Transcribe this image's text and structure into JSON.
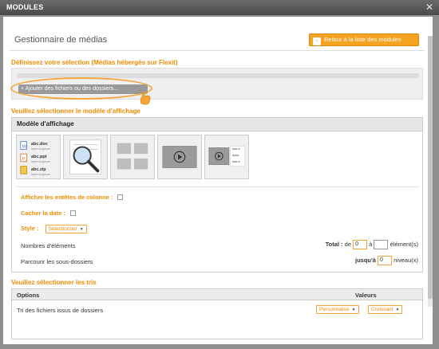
{
  "window": {
    "title": "MODULES"
  },
  "header": {
    "title": "Gestionnaire de médias",
    "back_button": "Retour à la liste des modules"
  },
  "selection": {
    "title": "Définissez votre sélection (Médias hébergés sur Flexit)",
    "add_button": "Ajouter des fichiers ou des dossiers..."
  },
  "model": {
    "section_title": "Veuillez sélectionner le modèle d'affichage",
    "panel_title": "Modèle d'affichage",
    "thumbnails": {
      "list": [
        {
          "name": "abc.doc",
          "sub": "lorem impsum"
        },
        {
          "name": "abc.ppt",
          "sub": "lorem impsum"
        },
        {
          "name": "abc.zip",
          "sub": "lorem impsum"
        }
      ],
      "lines": [
        "lore a",
        "dolor",
        "lore a"
      ]
    },
    "options": {
      "column_headers": "Afficher les entêtes de colonne :",
      "hide_date": "Cacher la date :",
      "style_label": "Style :",
      "style_value": "Sélectionner",
      "elements_label": "Nombres d'éléments",
      "total_label": "Total :",
      "from_label": "de",
      "from_value": "0",
      "to_label": "à",
      "to_value": "",
      "elements_unit": "élément(s)",
      "subfolders_label": "Parcourir les sous-dossiers",
      "depth_label": "jusqu'à",
      "depth_value": "0",
      "depth_unit": "niveau(x)"
    }
  },
  "tris": {
    "section_title": "Veuillez sélectionner les tris",
    "col_options": "Options",
    "col_values": "Valeurs",
    "row_label": "Tri des fichiers issus de dossiers",
    "sort_mode": "Personnalisé",
    "sort_order": "Croissant"
  }
}
